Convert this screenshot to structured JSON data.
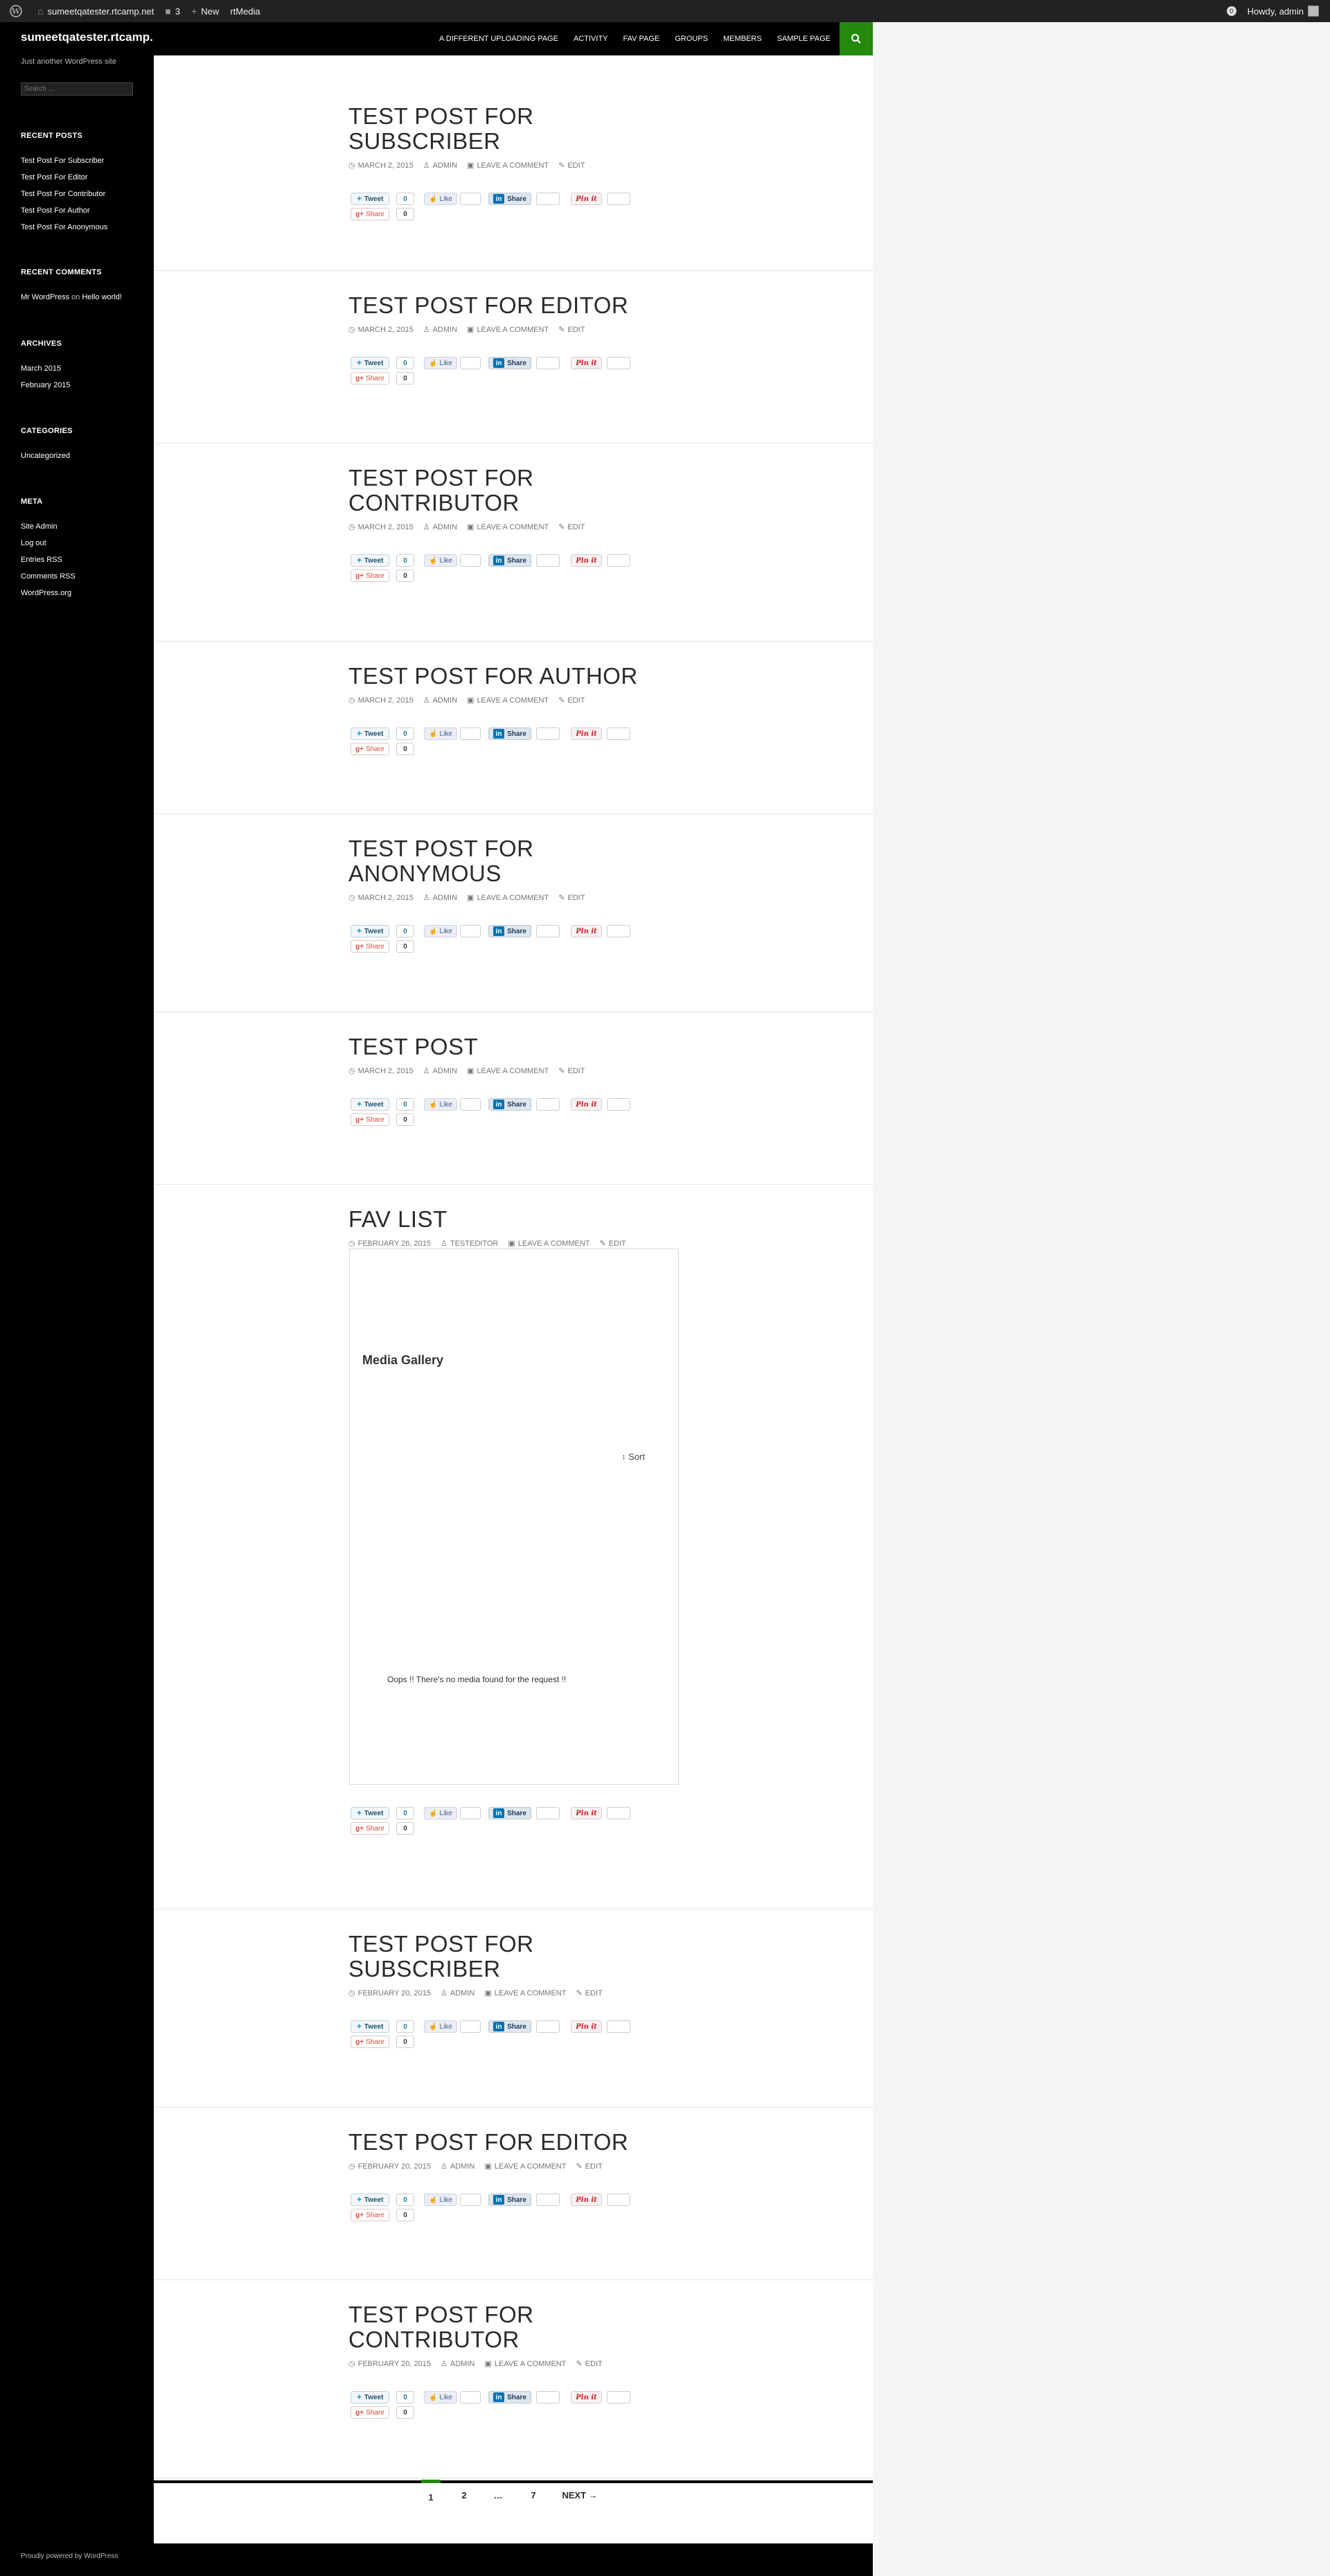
{
  "adminbar": {
    "site": "sumeetqatester.rtcamp.net",
    "comments": "3",
    "new": "New",
    "rtmedia": "rtMedia",
    "howdy": "Howdy, admin"
  },
  "site": {
    "title": "sumeetqatester.rtcamp.net",
    "description": "Just another WordPress site",
    "search_placeholder": "Search ..."
  },
  "nav": [
    "A DIFFERENT UPLOADING PAGE",
    "ACTIVITY",
    "FAV PAGE",
    "GROUPS",
    "MEMBERS",
    "SAMPLE PAGE"
  ],
  "widgets": {
    "recent_posts": {
      "title": "RECENT POSTS",
      "items": [
        "Test Post For Subscriber",
        "Test Post For Editor",
        "Test Post For Contributor",
        "Test Post For Author",
        "Test Post For Anonymous"
      ]
    },
    "recent_comments": {
      "title": "RECENT COMMENTS",
      "author": "Mr WordPress",
      "on": " on ",
      "post": "Hello world!"
    },
    "archives": {
      "title": "ARCHIVES",
      "items": [
        "March 2015",
        "February 2015"
      ]
    },
    "categories": {
      "title": "CATEGORIES",
      "items": [
        "Uncategorized"
      ]
    },
    "meta": {
      "title": "META",
      "items": [
        "Site Admin",
        "Log out",
        "Entries RSS",
        "Comments RSS",
        "WordPress.org"
      ]
    }
  },
  "share": {
    "tweet": "Tweet",
    "tweet_count": "0",
    "like": "Like",
    "linkedin": "Share",
    "pinit": "Pin it",
    "gplus": "Share",
    "gplus_count": "0"
  },
  "posts": [
    {
      "title": "TEST POST FOR SUBSCRIBER",
      "date": "MARCH 2, 2015",
      "author": "ADMIN",
      "comment": "LEAVE A COMMENT",
      "edit": "EDIT"
    },
    {
      "title": "TEST POST FOR EDITOR",
      "date": "MARCH 2, 2015",
      "author": "ADMIN",
      "comment": "LEAVE A COMMENT",
      "edit": "EDIT"
    },
    {
      "title": "TEST POST FOR CONTRIBUTOR",
      "date": "MARCH 2, 2015",
      "author": "ADMIN",
      "comment": "LEAVE A COMMENT",
      "edit": "EDIT"
    },
    {
      "title": "TEST POST FOR AUTHOR",
      "date": "MARCH 2, 2015",
      "author": "ADMIN",
      "comment": "LEAVE A COMMENT",
      "edit": "EDIT"
    },
    {
      "title": "TEST POST FOR ANONYMOUS",
      "date": "MARCH 2, 2015",
      "author": "ADMIN",
      "comment": "LEAVE A COMMENT",
      "edit": "EDIT"
    },
    {
      "title": "TEST POST",
      "date": "MARCH 2, 2015",
      "author": "ADMIN",
      "comment": "LEAVE A COMMENT",
      "edit": "EDIT"
    },
    {
      "title": "FAV LIST",
      "date": "FEBRUARY 26, 2015",
      "author": "TESTEDITOR",
      "comment": "LEAVE A COMMENT",
      "edit": "EDIT"
    },
    {
      "title": "TEST POST FOR SUBSCRIBER",
      "date": "FEBRUARY 20, 2015",
      "author": "ADMIN",
      "comment": "LEAVE A COMMENT",
      "edit": "EDIT"
    },
    {
      "title": "TEST POST FOR EDITOR",
      "date": "FEBRUARY 20, 2015",
      "author": "ADMIN",
      "comment": "LEAVE A COMMENT",
      "edit": "EDIT"
    },
    {
      "title": "TEST POST FOR CONTRIBUTOR",
      "date": "FEBRUARY 20, 2015",
      "author": "ADMIN",
      "comment": "LEAVE A COMMENT",
      "edit": "EDIT"
    }
  ],
  "gallery": {
    "title": "Media Gallery",
    "sort": "Sort",
    "empty": "Oops !! There's no media found for the request !!"
  },
  "pagination": [
    "1",
    "2",
    "…",
    "7",
    "NEXT →"
  ],
  "footer": {
    "credit": "Proudly powered by WordPress"
  },
  "colors": {
    "accent": "#24890d",
    "dark": "#000000",
    "page_bg": "#f5f5f5"
  }
}
